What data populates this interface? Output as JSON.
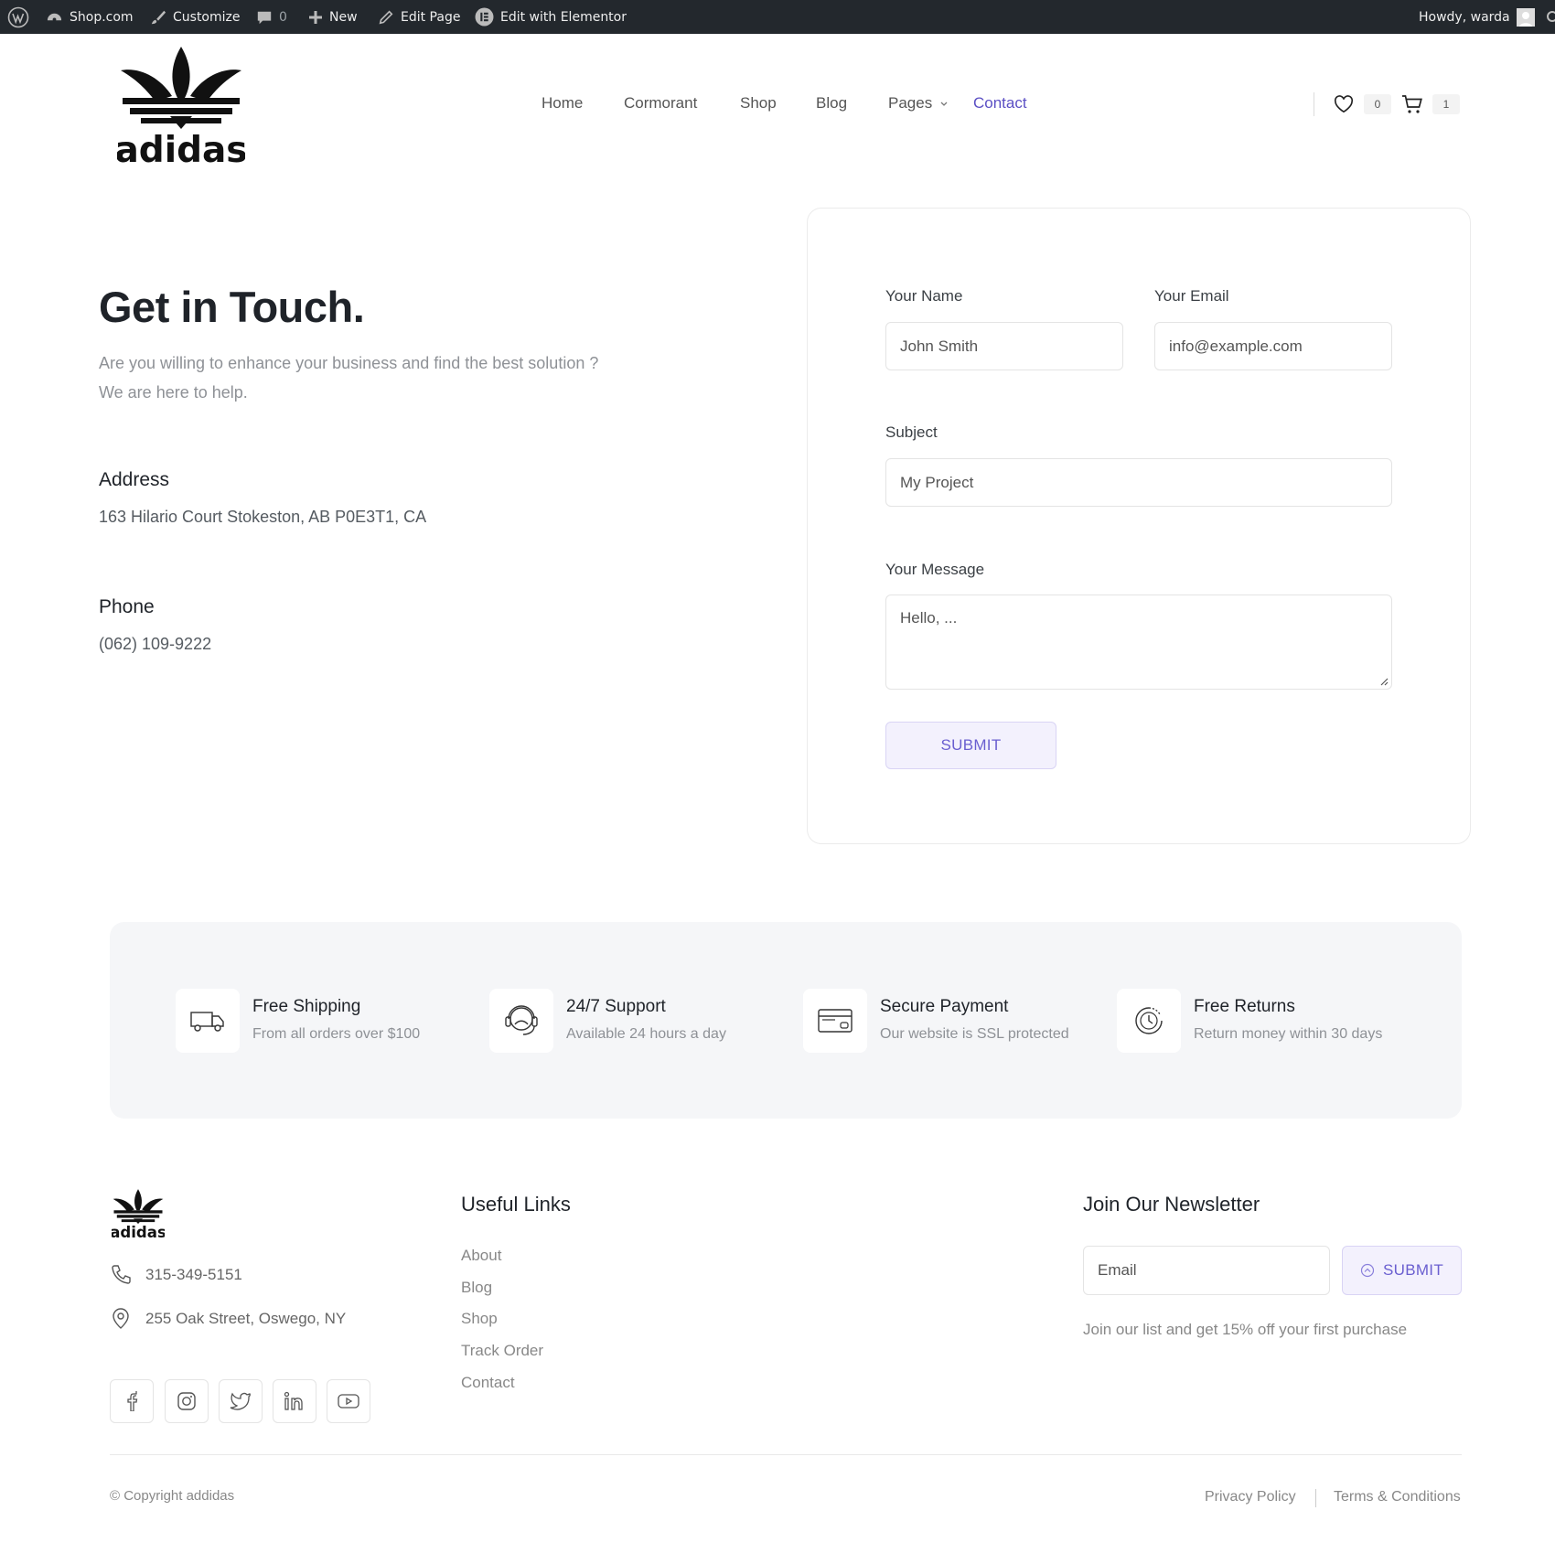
{
  "admin_bar": {
    "site_name": "Shop.com",
    "customize": "Customize",
    "comments_count": "0",
    "new": "New",
    "edit_page": "Edit Page",
    "edit_elementor": "Edit with Elementor",
    "howdy": "Howdy, warda"
  },
  "nav": {
    "items": [
      {
        "label": "Home"
      },
      {
        "label": "Cormorant"
      },
      {
        "label": "Shop"
      },
      {
        "label": "Blog"
      },
      {
        "label": "Pages"
      },
      {
        "label": "Contact",
        "active": true
      }
    ],
    "wishlist_count": "0",
    "cart_count": "1"
  },
  "contact": {
    "title": "Get in Touch.",
    "desc_line1": "Are you willing to enhance your business and find the best solution ?",
    "desc_line2": "We are here to help.",
    "address_label": "Address",
    "address_value": "163 Hilario Court Stokeston, AB P0E3T1, CA",
    "phone_label": "Phone",
    "phone_value": "(062) 109-9222"
  },
  "form": {
    "name_label": "Your Name",
    "name_placeholder": "John Smith",
    "email_label": "Your Email",
    "email_placeholder": "info@example.com",
    "subject_label": "Subject",
    "subject_placeholder": "My Project",
    "message_label": "Your Message",
    "message_placeholder": "Hello, ...",
    "submit": "SUBMIT"
  },
  "features": [
    {
      "title": "Free Shipping",
      "subtitle": "From all orders over $100",
      "icon": "truck-icon"
    },
    {
      "title": "24/7 Support",
      "subtitle": "Available 24 hours a day",
      "icon": "headset-icon"
    },
    {
      "title": "Secure Payment",
      "subtitle": "Our website is SSL protected",
      "icon": "credit-card-icon"
    },
    {
      "title": "Free Returns",
      "subtitle": "Return money within 30 days",
      "icon": "clock-return-icon"
    }
  ],
  "footer": {
    "phone": "315-349-5151",
    "address": "255 Oak Street, Oswego, NY",
    "useful_links_title": "Useful Links",
    "links": [
      "About",
      "Blog",
      "Shop",
      "Track Order",
      "Contact"
    ],
    "newsletter_title": "Join Our Newsletter",
    "newsletter_placeholder": "Email",
    "newsletter_submit": "SUBMIT",
    "newsletter_note": "Join our list and get 15% off your first purchase",
    "copyright": "© Copyright addidas",
    "privacy": "Privacy Policy",
    "terms": "Terms & Conditions"
  },
  "brand": {
    "logo_text": "adidas"
  },
  "colors": {
    "accent": "#5b4fc4",
    "admin_bar": "#23282d",
    "feature_bg": "#f5f6f8"
  }
}
